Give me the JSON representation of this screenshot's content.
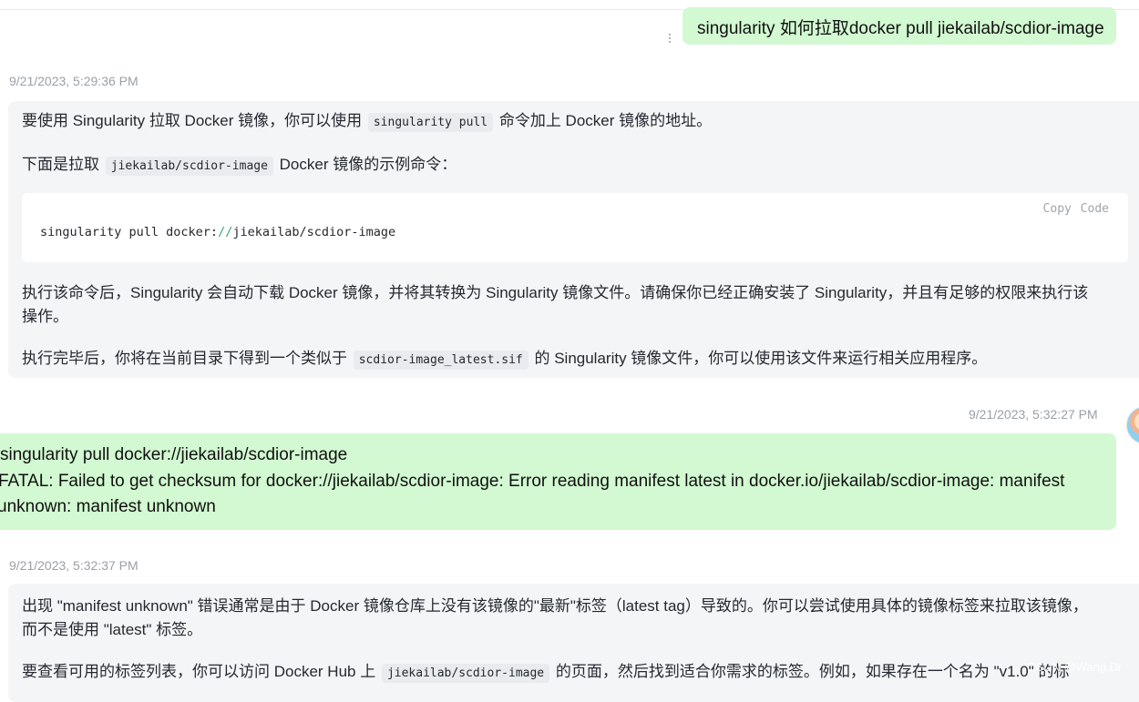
{
  "messages": {
    "user_1": {
      "text": "singularity 如何拉取docker pull jiekailab/scdior-image"
    },
    "assistant_1": {
      "timestamp": "9/21/2023, 5:29:36 PM",
      "p1_before": "要使用 Singularity 拉取 Docker 镜像，你可以使用",
      "p1_code": "singularity pull",
      "p1_after": "命令加上 Docker 镜像的地址。",
      "p2_before": "下面是拉取",
      "p2_code": "jiekailab/scdior-image",
      "p2_after": "Docker 镜像的示例命令：",
      "code_block": {
        "copy_label": "Copy Code",
        "code_prefix": "singularity pull docker:",
        "code_slashes": "//",
        "code_suffix": "jiekailab/scdior-image"
      },
      "p3_line1": "执行该命令后，Singularity 会自动下载 Docker 镜像，并将其转换为 Singularity 镜像文件。请确保你已经正确安装了 Singularity，并且有足够的权限来执行该",
      "p3_line2": "操作。",
      "p4_before": "执行完毕后，你将在当前目录下得到一个类似于",
      "p4_code": "scdior-image_latest.sif",
      "p4_after": "的 Singularity 镜像文件，你可以使用该文件来运行相关应用程序。"
    },
    "user_2": {
      "timestamp": "9/21/2023, 5:32:27 PM",
      "line1": "singularity pull docker://jiekailab/scdior-image",
      "line2": "FATAL:   Failed to get checksum for docker://jiekailab/scdior-image: Error reading manifest latest in docker.io/jiekailab/scdior-image: manifest",
      "line3": "unknown: manifest unknown"
    },
    "assistant_2": {
      "timestamp": "9/21/2023, 5:32:37 PM",
      "p1_line1": "出现 \"manifest unknown\" 错误通常是由于 Docker 镜像仓库上没有该镜像的\"最新\"标签（latest tag）导致的。你可以尝试使用具体的镜像标签来拉取该镜像，",
      "p1_line2": "而不是使用 \"latest\" 标签。",
      "p2_before": "要查看可用的标签列表，你可以访问 Docker Hub 上",
      "p2_code": "jiekailab/scdior-image",
      "p2_after": "的页面，然后找到适合你需求的标签。例如，如果存在一个名为 \"v1.0\" 的标"
    }
  },
  "watermark": "CSDN @Wang.Dr"
}
